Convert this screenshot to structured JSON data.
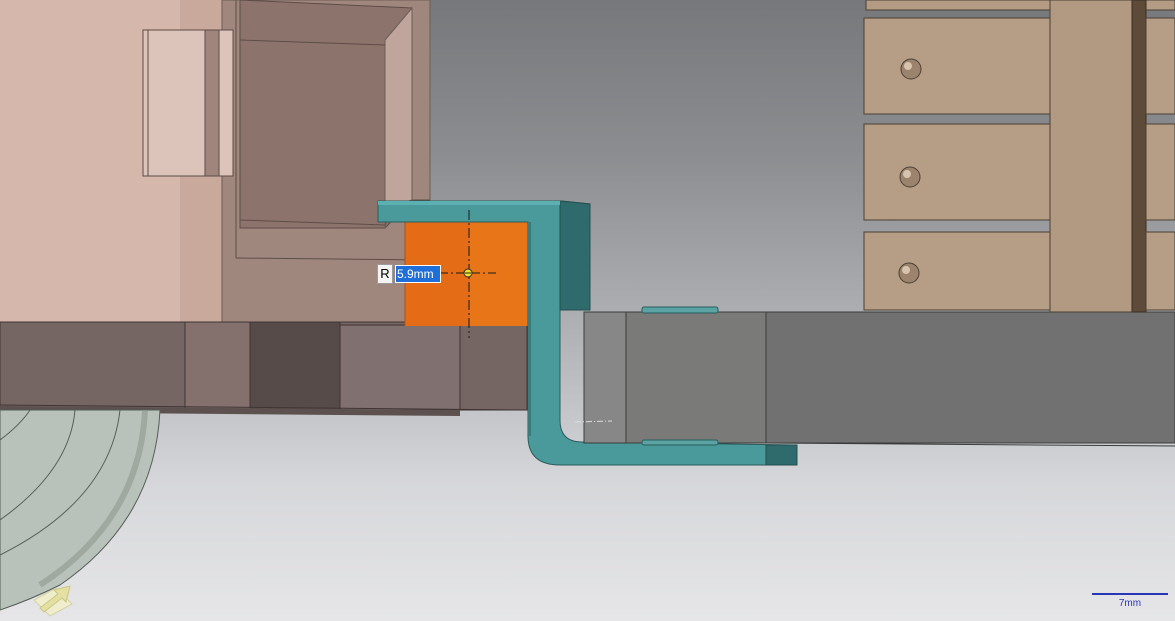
{
  "dimension": {
    "prefix": "R",
    "value": "5.9mm"
  },
  "scale_bar": {
    "label": "7mm"
  },
  "colors": {
    "selected_part": "#e46c17",
    "bracket": "#4a9a9b",
    "dimension_highlight": "#1e6fd9",
    "scale_bar": "#2a36b8"
  },
  "icons": {
    "orientation_triad": "view-triad-icon",
    "arc_center_marker": "center-point-icon"
  }
}
